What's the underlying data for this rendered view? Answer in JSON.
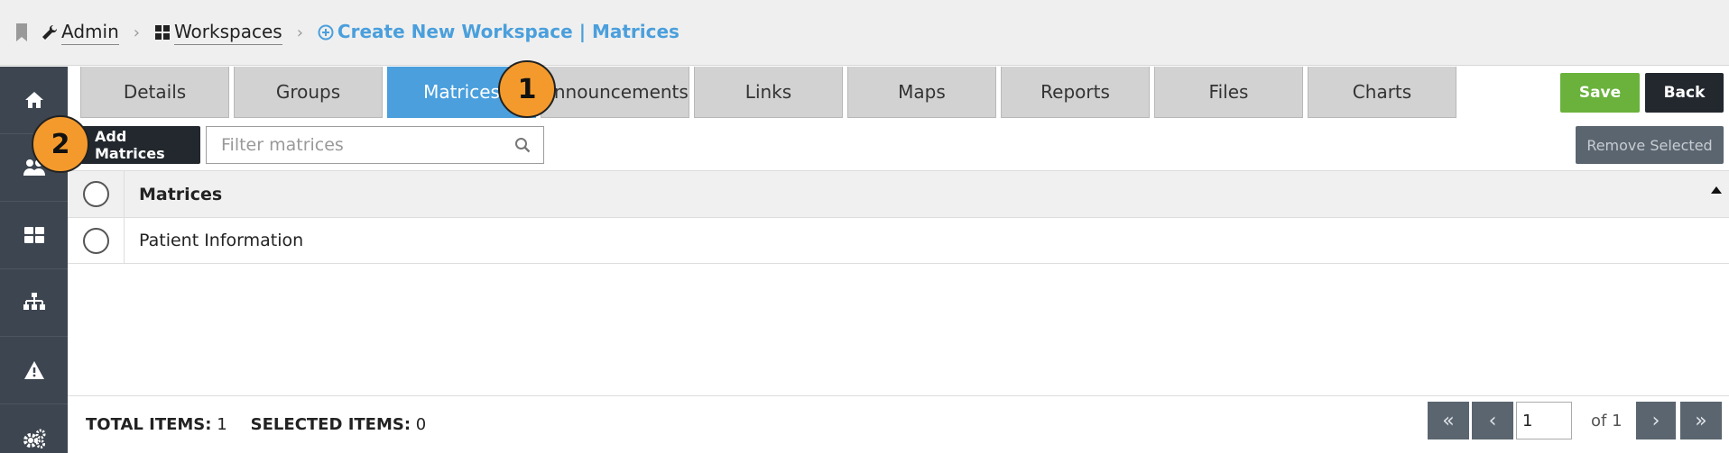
{
  "breadcrumb": {
    "admin": "Admin",
    "workspaces": "Workspaces",
    "current": "Create New Workspace | Matrices"
  },
  "sidebar": {
    "icons": [
      "home-icon",
      "users-icon",
      "grid-icon",
      "sitemap-icon",
      "warning-icon",
      "gears-icon"
    ]
  },
  "tabs": [
    "Details",
    "Groups",
    "Matrices",
    "Announcements",
    "Links",
    "Maps",
    "Reports",
    "Files",
    "Charts"
  ],
  "active_tab": "Matrices",
  "toolbar": {
    "save_label": "Save",
    "back_label": "Back",
    "add_label": "Add Matrices",
    "remove_label": "Remove Selected",
    "filter_placeholder": "Filter matrices"
  },
  "table": {
    "header": "Matrices",
    "rows": [
      "Patient Information"
    ]
  },
  "footer": {
    "total_label": "TOTAL ITEMS:",
    "total_value": "1",
    "selected_label": "SELECTED ITEMS:",
    "selected_value": "0",
    "page_value": "1",
    "page_of": "of 1"
  },
  "callouts": {
    "one": "1",
    "two": "2"
  },
  "colors": {
    "accent": "#4a9fdc",
    "save": "#6ab23c",
    "dark": "#22282e",
    "callout": "#f49a2c"
  }
}
